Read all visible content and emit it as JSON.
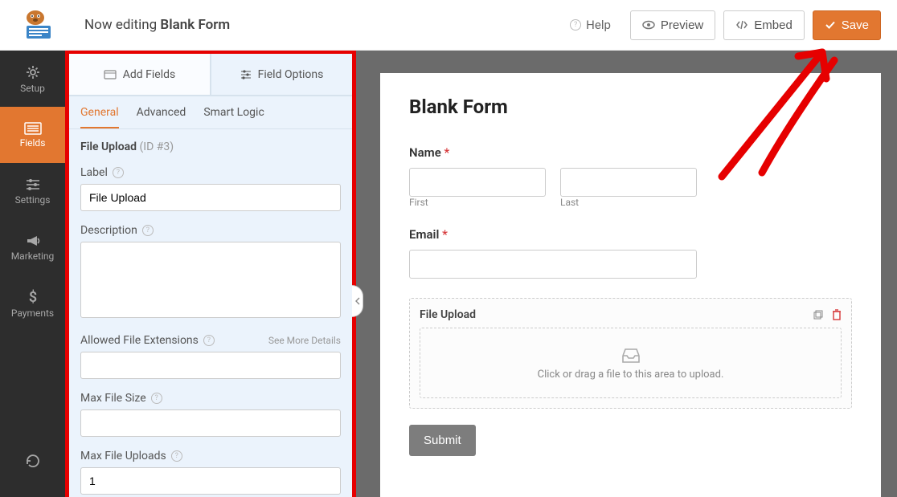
{
  "header": {
    "now_editing_prefix": "Now editing ",
    "form_name": "Blank Form",
    "help": "Help",
    "preview": "Preview",
    "embed": "Embed",
    "save": "Save"
  },
  "sidebar": {
    "items": [
      {
        "label": "Setup",
        "icon": "gear"
      },
      {
        "label": "Fields",
        "icon": "list"
      },
      {
        "label": "Settings",
        "icon": "sliders"
      },
      {
        "label": "Marketing",
        "icon": "bullhorn"
      },
      {
        "label": "Payments",
        "icon": "dollar"
      }
    ]
  },
  "panel": {
    "tabs": {
      "add_fields": "Add Fields",
      "field_options": "Field Options"
    },
    "subtabs": {
      "general": "General",
      "advanced": "Advanced",
      "smart_logic": "Smart Logic"
    },
    "field_type": "File Upload",
    "field_id_label": "(ID #3)",
    "label_label": "Label",
    "label_value": "File Upload",
    "description_label": "Description",
    "description_value": "",
    "extensions_label": "Allowed File Extensions",
    "extensions_value": "",
    "see_more": "See More Details",
    "max_size_label": "Max File Size",
    "max_size_value": "",
    "max_uploads_label": "Max File Uploads",
    "max_uploads_value": "1"
  },
  "preview": {
    "title": "Blank Form",
    "name_label": "Name",
    "first": "First",
    "last": "Last",
    "email_label": "Email",
    "file_upload_label": "File Upload",
    "drop_text": "Click or drag a file to this area to upload.",
    "submit": "Submit"
  }
}
